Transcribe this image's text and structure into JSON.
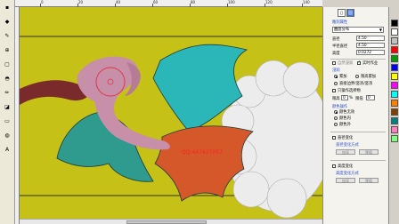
{
  "ruler_top": {
    "labels": [
      "0",
      "20",
      "40",
      "60",
      "80",
      "100",
      "120",
      "140"
    ]
  },
  "toolbar": {
    "tools": [
      {
        "name": "select-tool-icon",
        "glyph": "▪"
      },
      {
        "name": "shape-tool-icon",
        "glyph": "◆"
      },
      {
        "name": "node-tool-icon",
        "glyph": "✎"
      },
      {
        "name": "scale-tool-icon",
        "glyph": "⊕"
      },
      {
        "name": "crop-tool-icon",
        "glyph": "▢"
      },
      {
        "name": "brush-tool-icon",
        "glyph": "◓"
      },
      {
        "name": "pen-tool-icon",
        "glyph": "✏"
      },
      {
        "name": "fill-tool-icon",
        "glyph": "◪"
      },
      {
        "name": "eraser-tool-icon",
        "glyph": "▭"
      },
      {
        "name": "smooth-tool-icon",
        "glyph": "◍"
      },
      {
        "name": "text-tool-icon",
        "glyph": "A"
      }
    ]
  },
  "canvas": {
    "background": "#c6c117",
    "watermark": "QQ:447437057",
    "colors": {
      "stem": "#7a2a2a",
      "bird": "#c88fa8",
      "top_leaf": "#2bb6b8",
      "left_leaf": "#2f9a8e",
      "orange_leaf": "#d4582a",
      "flower": "#ececec"
    }
  },
  "panel": {
    "tabs": [
      "▯",
      "圆"
    ],
    "section_title": "雕刻属性",
    "mode_select": "曲面分布",
    "fields": [
      {
        "label": "直径",
        "value": "4.50"
      },
      {
        "label": "半径直径",
        "value": "4.50"
      },
      {
        "label": "高度",
        "value": "0.0272"
      }
    ],
    "check_auto": "自然浸润",
    "check_realtime": "实时作业",
    "group_label": "浸润",
    "radio_add": "累加",
    "radio_reduce": "限高累加",
    "radio_direct": "直接边界/竖浓/竖浓",
    "check_range": "只操作选择物",
    "step_label": "限高",
    "step_value": "0",
    "step_unit": "%",
    "step_extra": "限低",
    "step_extra_value": "0",
    "color_group": "颜色操作",
    "color_options": [
      "颜色无效",
      "颜色内",
      "颜色外"
    ],
    "check_line": "直径变化",
    "line_group": "直径变化方式",
    "btn_a": "加深",
    "btn_b": "等值",
    "check_height": "高度变化",
    "height_group": "高度变化方式",
    "btn_c": "加深",
    "btn_d": "等值"
  },
  "palette": {
    "colors": [
      "#000000",
      "#ffffff",
      "#c0c0c0",
      "#ff0000",
      "#00a000",
      "#0000ff",
      "#ffff00",
      "#ff00ff",
      "#00ffff",
      "#ff8000",
      "#804000",
      "#008080",
      "#ff80c0",
      "#80ff80"
    ]
  }
}
